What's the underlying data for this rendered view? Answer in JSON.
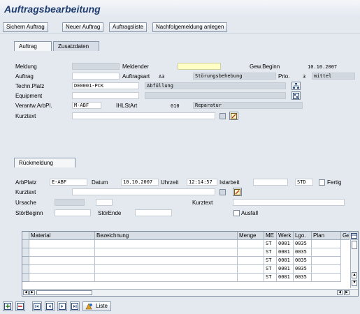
{
  "page": {
    "title": "Auftragsbearbeitung"
  },
  "toolbar": {
    "buttons": [
      "Sichern Auftrag",
      "Neuer Auftrag",
      "Auftragsliste",
      "Nachfolgemeldung anlegen"
    ]
  },
  "tabs_top": [
    "Auftrag",
    "Zusatzdaten"
  ],
  "auftrag": {
    "labels": {
      "meldung": "Meldung",
      "auftrag": "Auftrag",
      "techn_platz": "Techn.Platz",
      "equipment": "Equipment",
      "verantw": "Verantw.ArbPl.",
      "kurztext": "Kurztext",
      "meldender": "Meldender",
      "auftragsart": "Auftragsart",
      "ihlstart": "IHLStArt",
      "gew_beginn": "Gew.Beginn",
      "prio": "Prio."
    },
    "values": {
      "meldung": "",
      "auftrag": "",
      "techn_platz": "DE0001-PCK",
      "techn_platz_desc": "Abfüllung",
      "equipment": "",
      "equipment_desc": "",
      "verantw": "M-ABF",
      "meldender": "",
      "auftragsart": "A3",
      "auftragsart_desc": "Störungsbehebung",
      "ihlstart": "010",
      "ihlstart_desc": "Reparatur",
      "gew_beginn": "10.10.2007",
      "prio": "3",
      "prio_desc": "mittel",
      "kurztext": ""
    }
  },
  "tabs_bottom": [
    "Rückmeldung"
  ],
  "rueckmeldung": {
    "labels": {
      "arbplatz": "ArbPlatz",
      "datum": "Datum",
      "uhrzeit": "Uhrzeit",
      "istarbeit": "Istarbeit",
      "kurztext": "Kurztext",
      "ursache": "Ursache",
      "kurztext2": "Kurztext",
      "stoerbeginn": "StörBeginn",
      "stoerende": "StörEnde",
      "ausfall": "Ausfall",
      "fertig": "Fertig"
    },
    "values": {
      "arbplatz": "E-ABF",
      "datum": "10.10.2007",
      "uhrzeit": "12:14:57",
      "istarbeit": "",
      "einheit": "STD",
      "kurztext": "",
      "ursache": "",
      "kurztext2": "",
      "stoerbeginn": "",
      "stoerende": ""
    }
  },
  "table": {
    "columns": [
      "Material",
      "Bezeichnung",
      "Menge",
      "ME",
      "Werk",
      "Lgo.",
      "Plan",
      "Ge"
    ],
    "rows": [
      [
        "",
        "",
        "",
        "ST",
        "0001",
        "0035",
        ""
      ],
      [
        "",
        "",
        "",
        "ST",
        "0001",
        "0035",
        ""
      ],
      [
        "",
        "",
        "",
        "ST",
        "0001",
        "0035",
        ""
      ],
      [
        "",
        "",
        "",
        "ST",
        "0001",
        "0035",
        ""
      ],
      [
        "",
        "",
        "",
        "ST",
        "0001",
        "0035",
        ""
      ]
    ]
  },
  "bottom_toolbar": {
    "liste_label": "Liste"
  },
  "colors": {
    "title": "#1f3c6e",
    "background": "#e4e9ef",
    "required": "#ffffc6"
  }
}
